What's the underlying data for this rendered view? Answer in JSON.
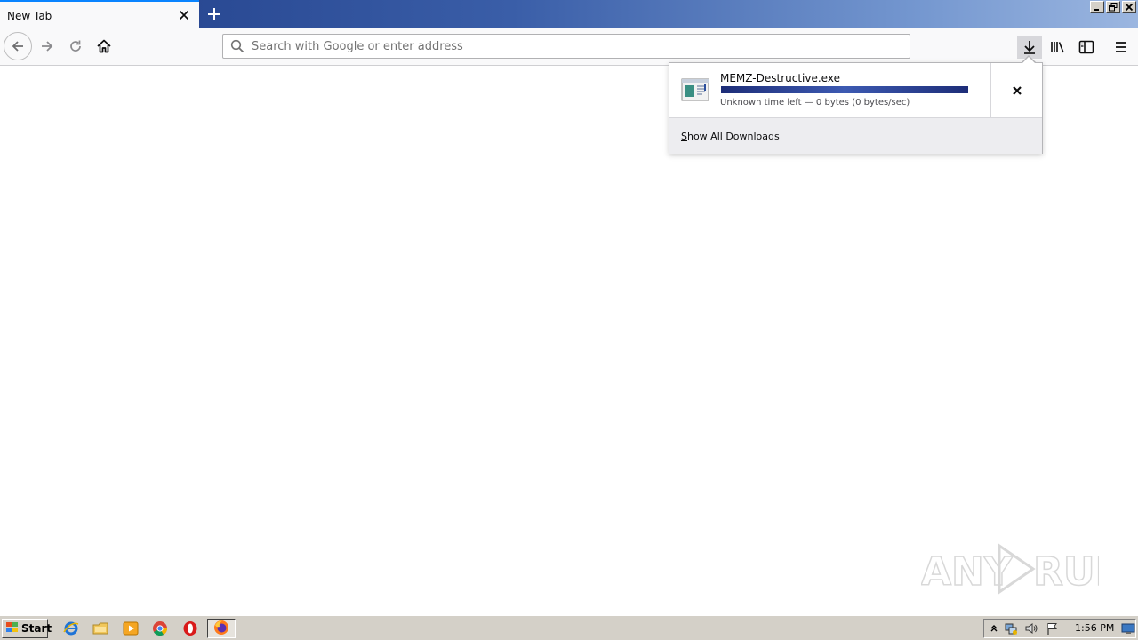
{
  "browser": {
    "tab": {
      "title": "New Tab"
    },
    "urlbar": {
      "placeholder": "Search with Google or enter address",
      "value": ""
    }
  },
  "downloads_panel": {
    "item": {
      "filename": "MEMZ-Destructive.exe",
      "status": "Unknown time left — 0 bytes (0 bytes/sec)",
      "progress": 1.0
    },
    "show_all": {
      "access_key": "S",
      "rest": "how All Downloads"
    }
  },
  "taskbar": {
    "start_label": "Start",
    "clock": "1:56 PM"
  },
  "watermark": {
    "text": "ANY RUN"
  },
  "icons": {
    "tab_close": "close-icon",
    "new_tab": "plus-icon",
    "back": "arrow-left-icon",
    "forward": "arrow-right-icon",
    "reload": "reload-icon",
    "home": "home-icon",
    "search": "search-icon",
    "downloads": "download-arrow-icon",
    "library": "library-icon",
    "sidebar": "sidebar-icon",
    "menu": "hamburger-menu-icon"
  },
  "colors": {
    "accent": "#0a84ff",
    "progress": "#1d2d78",
    "titlebar_start": "#1f3c86",
    "titlebar_end": "#9bb6e0"
  }
}
